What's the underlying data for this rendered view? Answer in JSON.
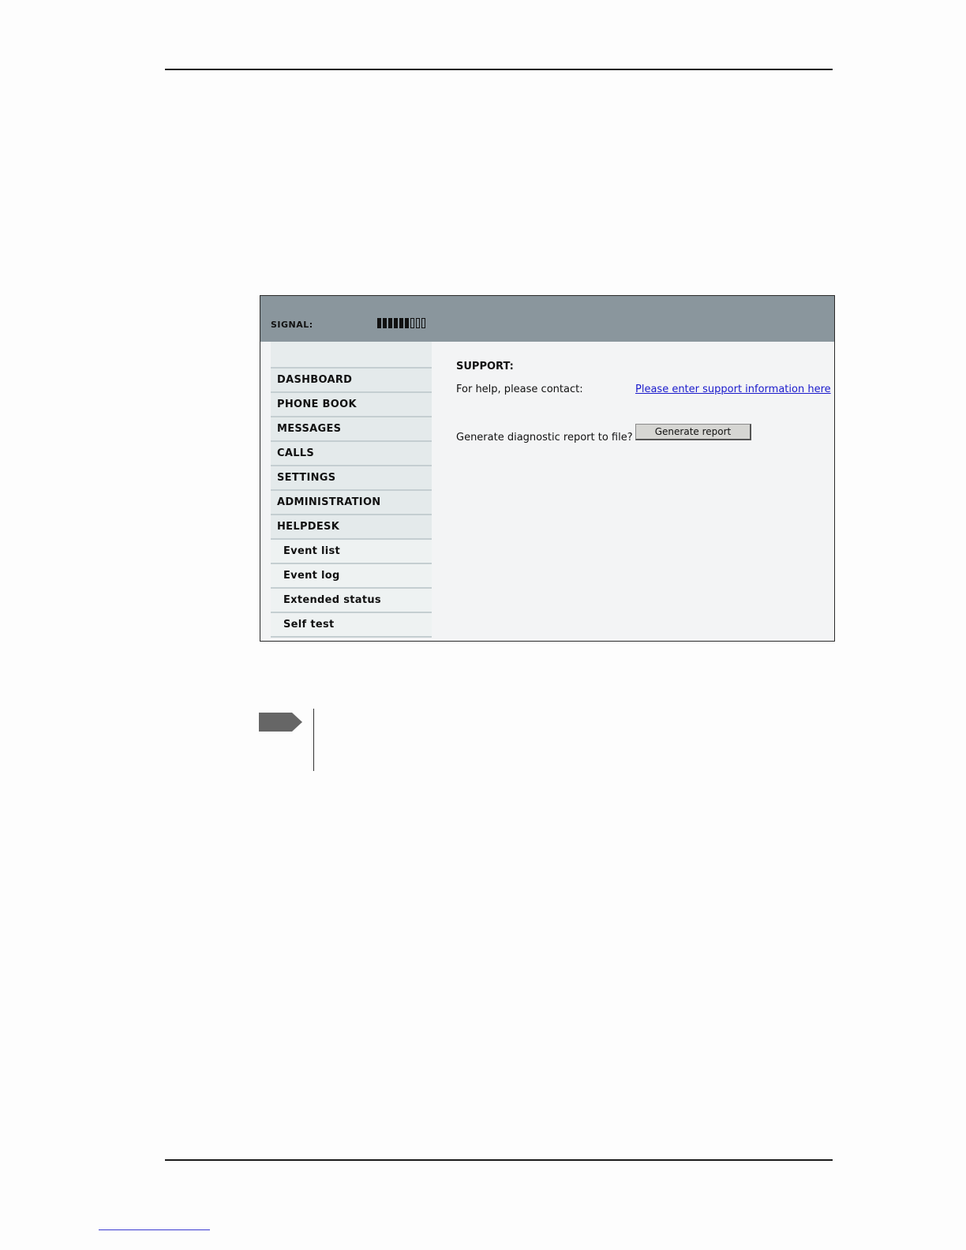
{
  "signal": {
    "label": "SIGNAL:",
    "strength_filled": 6,
    "strength_total": 9
  },
  "sidebar": {
    "items": [
      {
        "label": "DASHBOARD",
        "sub": false
      },
      {
        "label": "PHONE BOOK",
        "sub": false
      },
      {
        "label": "MESSAGES",
        "sub": false
      },
      {
        "label": "CALLS",
        "sub": false
      },
      {
        "label": "SETTINGS",
        "sub": false
      },
      {
        "label": "ADMINISTRATION",
        "sub": false
      },
      {
        "label": "HELPDESK",
        "sub": false
      },
      {
        "label": "Event list",
        "sub": true
      },
      {
        "label": "Event log",
        "sub": true
      },
      {
        "label": "Extended status",
        "sub": true
      },
      {
        "label": "Self test",
        "sub": true
      }
    ]
  },
  "main": {
    "title": "SUPPORT:",
    "help_label": "For help, please contact:",
    "help_link": "Please enter support information here",
    "diag_label": "Generate diagnostic report to file?",
    "generate_button": "Generate report"
  },
  "colors": {
    "header": "#8a969d",
    "content_bg": "#f3f4f5",
    "link": "#1a1acc",
    "note_arrow": "#666666"
  },
  "icons": {
    "note_marker": "note-arrow-icon"
  }
}
